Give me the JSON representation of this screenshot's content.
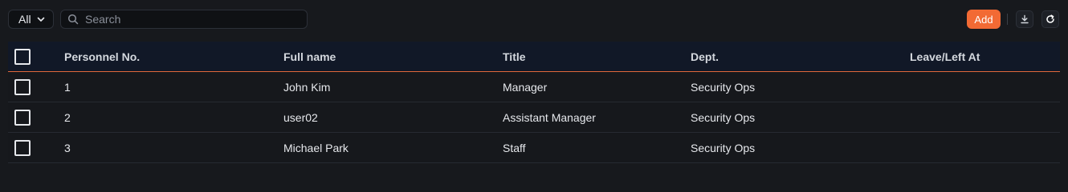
{
  "toolbar": {
    "filter_value": "All",
    "search_placeholder": "Search",
    "add_label": "Add"
  },
  "table": {
    "headers": {
      "no": "Personnel No.",
      "name": "Full name",
      "title": "Title",
      "dept": "Dept.",
      "leave": "Leave/Left At"
    },
    "rows": [
      {
        "no": "1",
        "name": "John Kim",
        "title": "Manager",
        "dept": "Security Ops",
        "leave": ""
      },
      {
        "no": "2",
        "name": "user02",
        "title": "Assistant Manager",
        "dept": "Security Ops",
        "leave": ""
      },
      {
        "no": "3",
        "name": "Michael Park",
        "title": "Staff",
        "dept": "Security Ops",
        "leave": ""
      }
    ]
  },
  "colors": {
    "accent": "#f26a34",
    "background": "#17191d",
    "header_bg": "#111827"
  },
  "icons": {
    "filter": "chevron-down-icon",
    "search": "search-icon",
    "download": "download-icon",
    "refresh": "refresh-icon"
  }
}
